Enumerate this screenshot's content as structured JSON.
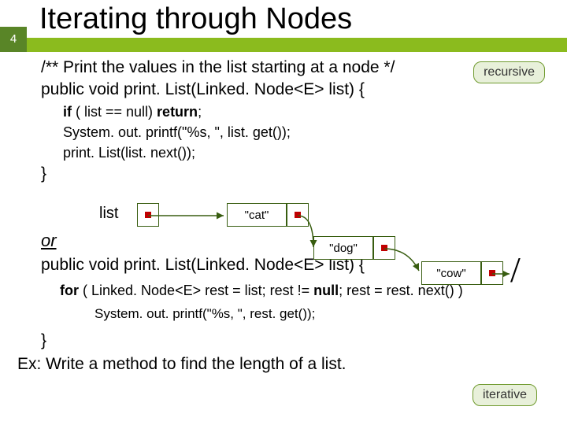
{
  "page_number": "4",
  "title": "Iterating through Nodes",
  "comment": "/** Print the values in the list starting at a node */",
  "sig1": "public void print. List(Linked. Node<E> list) {",
  "body": {
    "l1a": "if",
    "l1b": " ( list == null) ",
    "l1c": "return",
    "l1d": ";",
    "l2": "System. out. printf(\"%s, \", list. get());",
    "l3": "print. List(list. next());"
  },
  "close1": "}",
  "list_label": "list",
  "nodes": {
    "n1": "\"cat\"",
    "n2": "\"dog\"",
    "n3": "\"cow\""
  },
  "slash": "/",
  "or_label": "or",
  "sig2": "public void print. List(Linked. Node<E> list) {",
  "for_line": {
    "a": "for",
    "b": " ( Linked. Node<E> rest = list;  rest != ",
    "c": "null",
    "d": ";   rest = rest. next() )"
  },
  "print2": "System. out. printf(\"%s, \", rest. get());",
  "close2": "}",
  "ex": "Ex: Write a method to find the length of a list.",
  "callouts": {
    "recursive": "recursive",
    "iterative": "iterative"
  }
}
